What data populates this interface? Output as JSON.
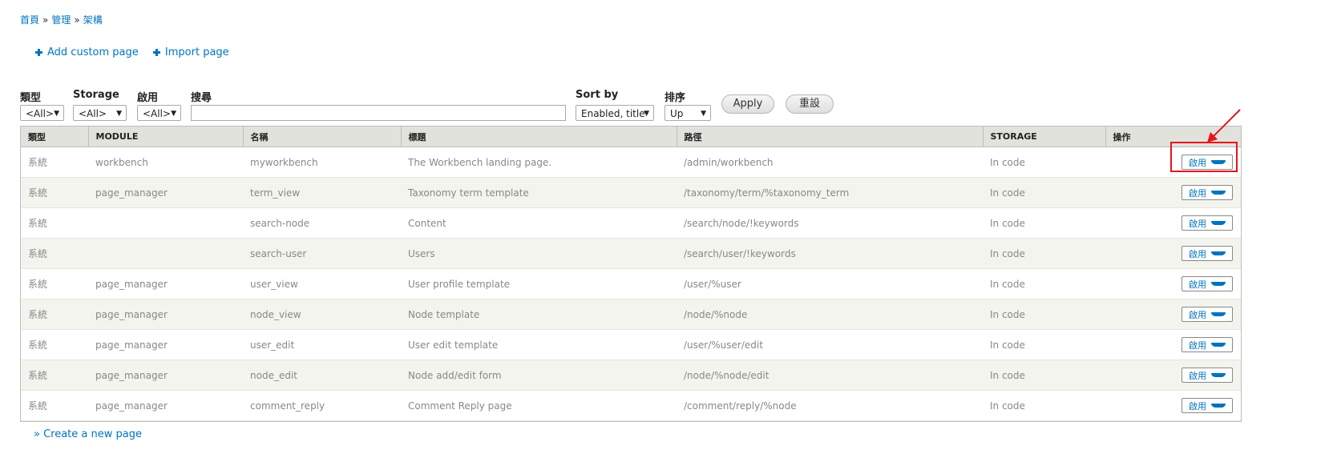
{
  "breadcrumb": {
    "items": [
      "首頁",
      "管理",
      "架構"
    ],
    "separator": "»"
  },
  "actions": {
    "add_custom_page": "Add custom page",
    "import_page": "Import page"
  },
  "filters": {
    "type": {
      "label": "類型",
      "value": "<All>"
    },
    "storage": {
      "label": "Storage",
      "value": "<All>"
    },
    "enabled": {
      "label": "啟用",
      "value": "<All>"
    },
    "search": {
      "label": "搜尋",
      "value": ""
    },
    "sort_by": {
      "label": "Sort by",
      "value": "Enabled, title"
    },
    "order": {
      "label": "排序",
      "value": "Up"
    },
    "apply_label": "Apply",
    "reset_label": "重設"
  },
  "table": {
    "headers": [
      "類型",
      "MODULE",
      "名稱",
      "標題",
      "路徑",
      "STORAGE",
      "操作"
    ],
    "rows": [
      {
        "type": "系統",
        "module": "workbench",
        "name": "myworkbench",
        "title": "The Workbench landing page.",
        "path": "/admin/workbench",
        "storage": "In code",
        "op": "啟用"
      },
      {
        "type": "系統",
        "module": "page_manager",
        "name": "term_view",
        "title": "Taxonomy term template",
        "path": "/taxonomy/term/%taxonomy_term",
        "storage": "In code",
        "op": "啟用"
      },
      {
        "type": "系統",
        "module": "",
        "name": "search-node",
        "title": "Content",
        "path": "/search/node/!keywords",
        "storage": "In code",
        "op": "啟用"
      },
      {
        "type": "系統",
        "module": "",
        "name": "search-user",
        "title": "Users",
        "path": "/search/user/!keywords",
        "storage": "In code",
        "op": "啟用"
      },
      {
        "type": "系統",
        "module": "page_manager",
        "name": "user_view",
        "title": "User profile template",
        "path": "/user/%user",
        "storage": "In code",
        "op": "啟用"
      },
      {
        "type": "系統",
        "module": "page_manager",
        "name": "node_view",
        "title": "Node template",
        "path": "/node/%node",
        "storage": "In code",
        "op": "啟用"
      },
      {
        "type": "系統",
        "module": "page_manager",
        "name": "user_edit",
        "title": "User edit template",
        "path": "/user/%user/edit",
        "storage": "In code",
        "op": "啟用"
      },
      {
        "type": "系統",
        "module": "page_manager",
        "name": "node_edit",
        "title": "Node add/edit form",
        "path": "/node/%node/edit",
        "storage": "In code",
        "op": "啟用"
      },
      {
        "type": "系統",
        "module": "page_manager",
        "name": "comment_reply",
        "title": "Comment Reply page",
        "path": "/comment/reply/%node",
        "storage": "In code",
        "op": "啟用"
      }
    ]
  },
  "footer": {
    "create_link": "» Create a new page"
  },
  "colors": {
    "link": "#0074bd",
    "highlight": "#e8141c",
    "header_bg": "#e1e2dc",
    "even_row_bg": "#f3f4ee"
  }
}
